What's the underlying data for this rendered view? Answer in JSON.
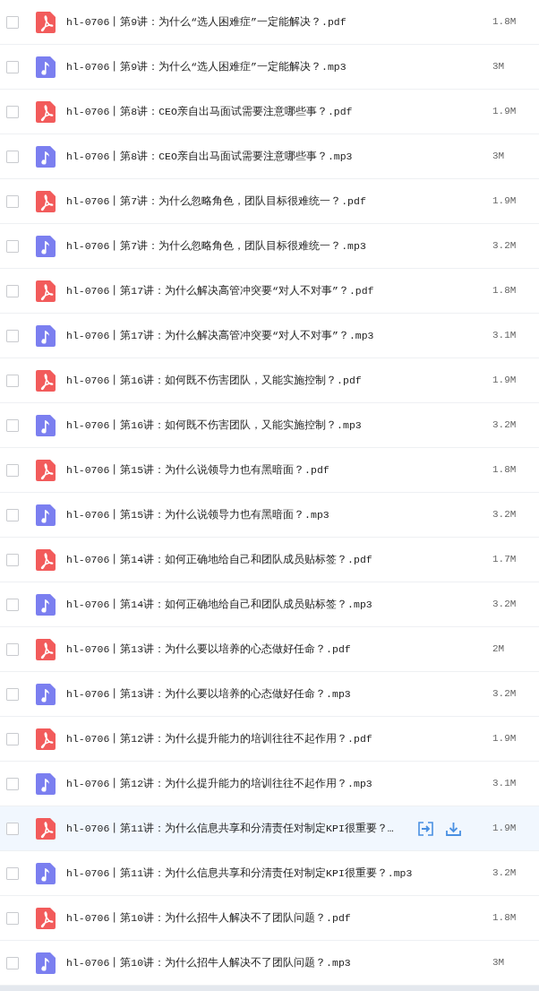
{
  "files": [
    {
      "kind": "pdf",
      "name": "hl-0706丨第9讲：为什么“选人困难症”一定能解决？.pdf",
      "size": "1.8M",
      "checked": false,
      "hovered": false
    },
    {
      "kind": "mp3",
      "name": "hl-0706丨第9讲：为什么“选人困难症”一定能解决？.mp3",
      "size": "3M",
      "checked": false,
      "hovered": false
    },
    {
      "kind": "pdf",
      "name": "hl-0706丨第8讲：CEO亲自出马面试需要注意哪些事？.pdf",
      "size": "1.9M",
      "checked": false,
      "hovered": false
    },
    {
      "kind": "mp3",
      "name": "hl-0706丨第8讲：CEO亲自出马面试需要注意哪些事？.mp3",
      "size": "3M",
      "checked": false,
      "hovered": false
    },
    {
      "kind": "pdf",
      "name": "hl-0706丨第7讲：为什么忽略角色，团队目标很难统一？.pdf",
      "size": "1.9M",
      "checked": false,
      "hovered": false
    },
    {
      "kind": "mp3",
      "name": "hl-0706丨第7讲：为什么忽略角色，团队目标很难统一？.mp3",
      "size": "3.2M",
      "checked": false,
      "hovered": false
    },
    {
      "kind": "pdf",
      "name": "hl-0706丨第17讲：为什么解决高管冲突要“对人不对事”？.pdf",
      "size": "1.8M",
      "checked": false,
      "hovered": false
    },
    {
      "kind": "mp3",
      "name": "hl-0706丨第17讲：为什么解决高管冲突要“对人不对事”？.mp3",
      "size": "3.1M",
      "checked": false,
      "hovered": false
    },
    {
      "kind": "pdf",
      "name": "hl-0706丨第16讲：如何既不伤害团队，又能实施控制？.pdf",
      "size": "1.9M",
      "checked": false,
      "hovered": false
    },
    {
      "kind": "mp3",
      "name": "hl-0706丨第16讲：如何既不伤害团队，又能实施控制？.mp3",
      "size": "3.2M",
      "checked": false,
      "hovered": false
    },
    {
      "kind": "pdf",
      "name": "hl-0706丨第15讲：为什么说领导力也有黑暗面？.pdf",
      "size": "1.8M",
      "checked": false,
      "hovered": false
    },
    {
      "kind": "mp3",
      "name": "hl-0706丨第15讲：为什么说领导力也有黑暗面？.mp3",
      "size": "3.2M",
      "checked": false,
      "hovered": false
    },
    {
      "kind": "pdf",
      "name": "hl-0706丨第14讲：如何正确地给自己和团队成员贴标签？.pdf",
      "size": "1.7M",
      "checked": false,
      "hovered": false
    },
    {
      "kind": "mp3",
      "name": "hl-0706丨第14讲：如何正确地给自己和团队成员贴标签？.mp3",
      "size": "3.2M",
      "checked": false,
      "hovered": false
    },
    {
      "kind": "pdf",
      "name": "hl-0706丨第13讲：为什么要以培养的心态做好任命？.pdf",
      "size": "2M",
      "checked": false,
      "hovered": false
    },
    {
      "kind": "mp3",
      "name": "hl-0706丨第13讲：为什么要以培养的心态做好任命？.mp3",
      "size": "3.2M",
      "checked": false,
      "hovered": false
    },
    {
      "kind": "pdf",
      "name": "hl-0706丨第12讲：为什么提升能力的培训往往不起作用？.pdf",
      "size": "1.9M",
      "checked": false,
      "hovered": false
    },
    {
      "kind": "mp3",
      "name": "hl-0706丨第12讲：为什么提升能力的培训往往不起作用？.mp3",
      "size": "3.1M",
      "checked": false,
      "hovered": false
    },
    {
      "kind": "pdf",
      "name": "hl-0706丨第11讲：为什么信息共享和分清责任对制定KPI很重要？…",
      "size": "1.9M",
      "checked": false,
      "hovered": true
    },
    {
      "kind": "mp3",
      "name": "hl-0706丨第11讲：为什么信息共享和分清责任对制定KPI很重要？.mp3",
      "size": "3.2M",
      "checked": false,
      "hovered": false
    },
    {
      "kind": "pdf",
      "name": "hl-0706丨第10讲：为什么招牛人解决不了团队问题？.pdf",
      "size": "1.8M",
      "checked": false,
      "hovered": false
    },
    {
      "kind": "mp3",
      "name": "hl-0706丨第10讲：为什么招牛人解决不了团队问题？.mp3",
      "size": "3M",
      "checked": false,
      "hovered": false
    }
  ]
}
